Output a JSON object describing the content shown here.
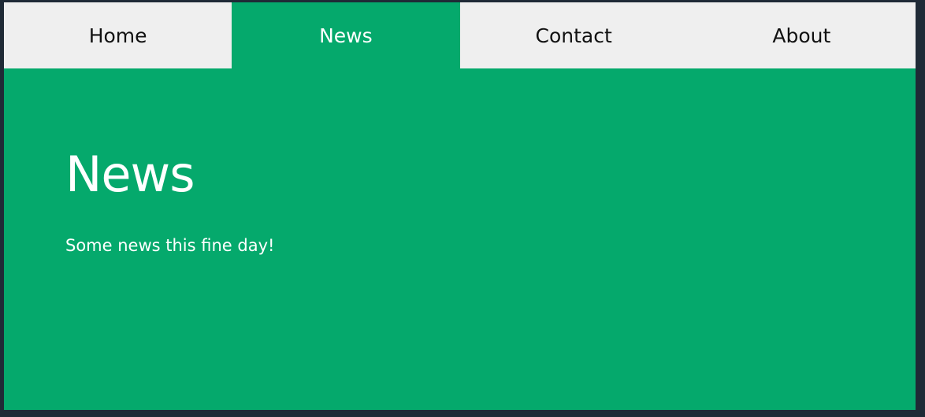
{
  "nav": {
    "tabs": [
      {
        "label": "Home"
      },
      {
        "label": "News"
      },
      {
        "label": "Contact"
      },
      {
        "label": "About"
      }
    ],
    "active_tab": "News"
  },
  "main": {
    "heading": "News",
    "text": "Some news this fine day!"
  },
  "colors": {
    "accent": "#05a96c",
    "tab_background": "#efefef",
    "page_background": "#1f2a36"
  }
}
